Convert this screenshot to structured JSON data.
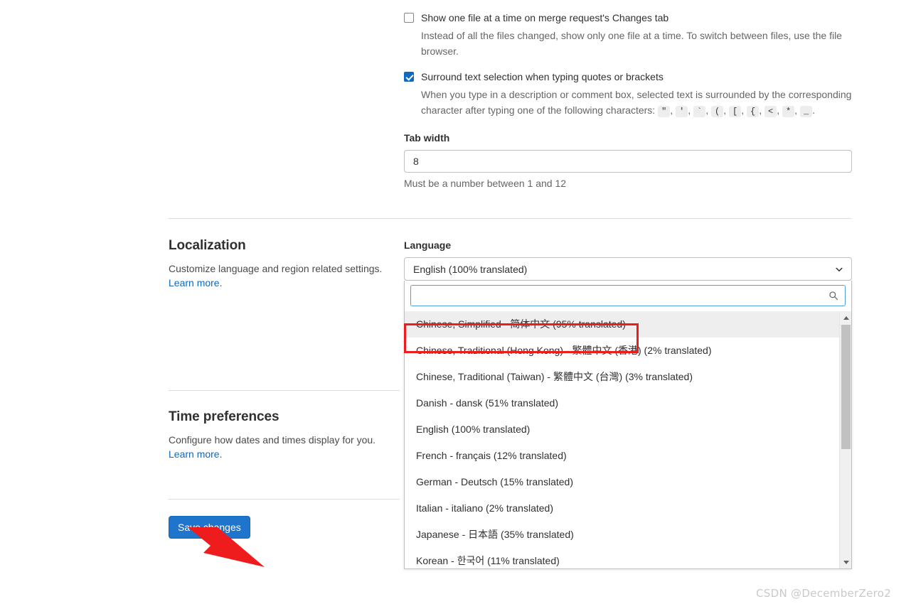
{
  "preferences": {
    "behavior": {
      "single_file_checkbox": {
        "label": "Show one file at a time on merge request's Changes tab",
        "checked": false,
        "help": "Instead of all the files changed, show only one file at a time. To switch between files, use the file browser."
      },
      "surround_checkbox": {
        "label": "Surround text selection when typing quotes or brackets",
        "checked": true,
        "help_prefix": "When you type in a description or comment box, selected text is surrounded by the corresponding character after typing one of the following characters:",
        "keys": [
          "\"",
          "'",
          "`",
          "(",
          "[",
          "{",
          "<",
          "*",
          "_"
        ],
        "help_suffix": "."
      },
      "tab_width": {
        "label": "Tab width",
        "value": "8",
        "help": "Must be a number between 1 and 12"
      }
    },
    "localization": {
      "title": "Localization",
      "description": "Customize language and region related settings.",
      "learn_more": "Learn more",
      "period": ".",
      "language": {
        "label": "Language",
        "selected": "English (100% translated)",
        "search_value": "",
        "search_placeholder": "",
        "options": [
          "Chinese, Simplified - 简体中文 (95% translated)",
          "Chinese, Traditional (Hong Kong) - 繁體中文 (香港) (2% translated)",
          "Chinese, Traditional (Taiwan) - 繁體中文 (台灣) (3% translated)",
          "Danish - dansk (51% translated)",
          "English (100% translated)",
          "French - français (12% translated)",
          "German - Deutsch (15% translated)",
          "Italian - italiano (2% translated)",
          "Japanese - 日本語 (35% translated)",
          "Korean - 한국어 (11% translated)"
        ],
        "highlighted_index": 0
      }
    },
    "time_preferences": {
      "title": "Time preferences",
      "description": "Configure how dates and times display for you.",
      "learn_more": "Learn more",
      "period": "."
    },
    "save_button": "Save changes"
  },
  "icons": {
    "chevron_down": "chevron-down-icon",
    "search": "search-icon",
    "scroll_up": "scroll-up-arrow-icon",
    "scroll_down": "scroll-down-arrow-icon",
    "pointer_arrow": "red-pointer-arrow"
  },
  "colors": {
    "accent_blue": "#1f75cb",
    "link_blue": "#1068bf",
    "annotation_red": "#ee1c1c",
    "checkbox_blue": "#1068bf",
    "highlight_gray": "#eeeeee"
  },
  "watermark": "CSDN @DecemberZero2"
}
